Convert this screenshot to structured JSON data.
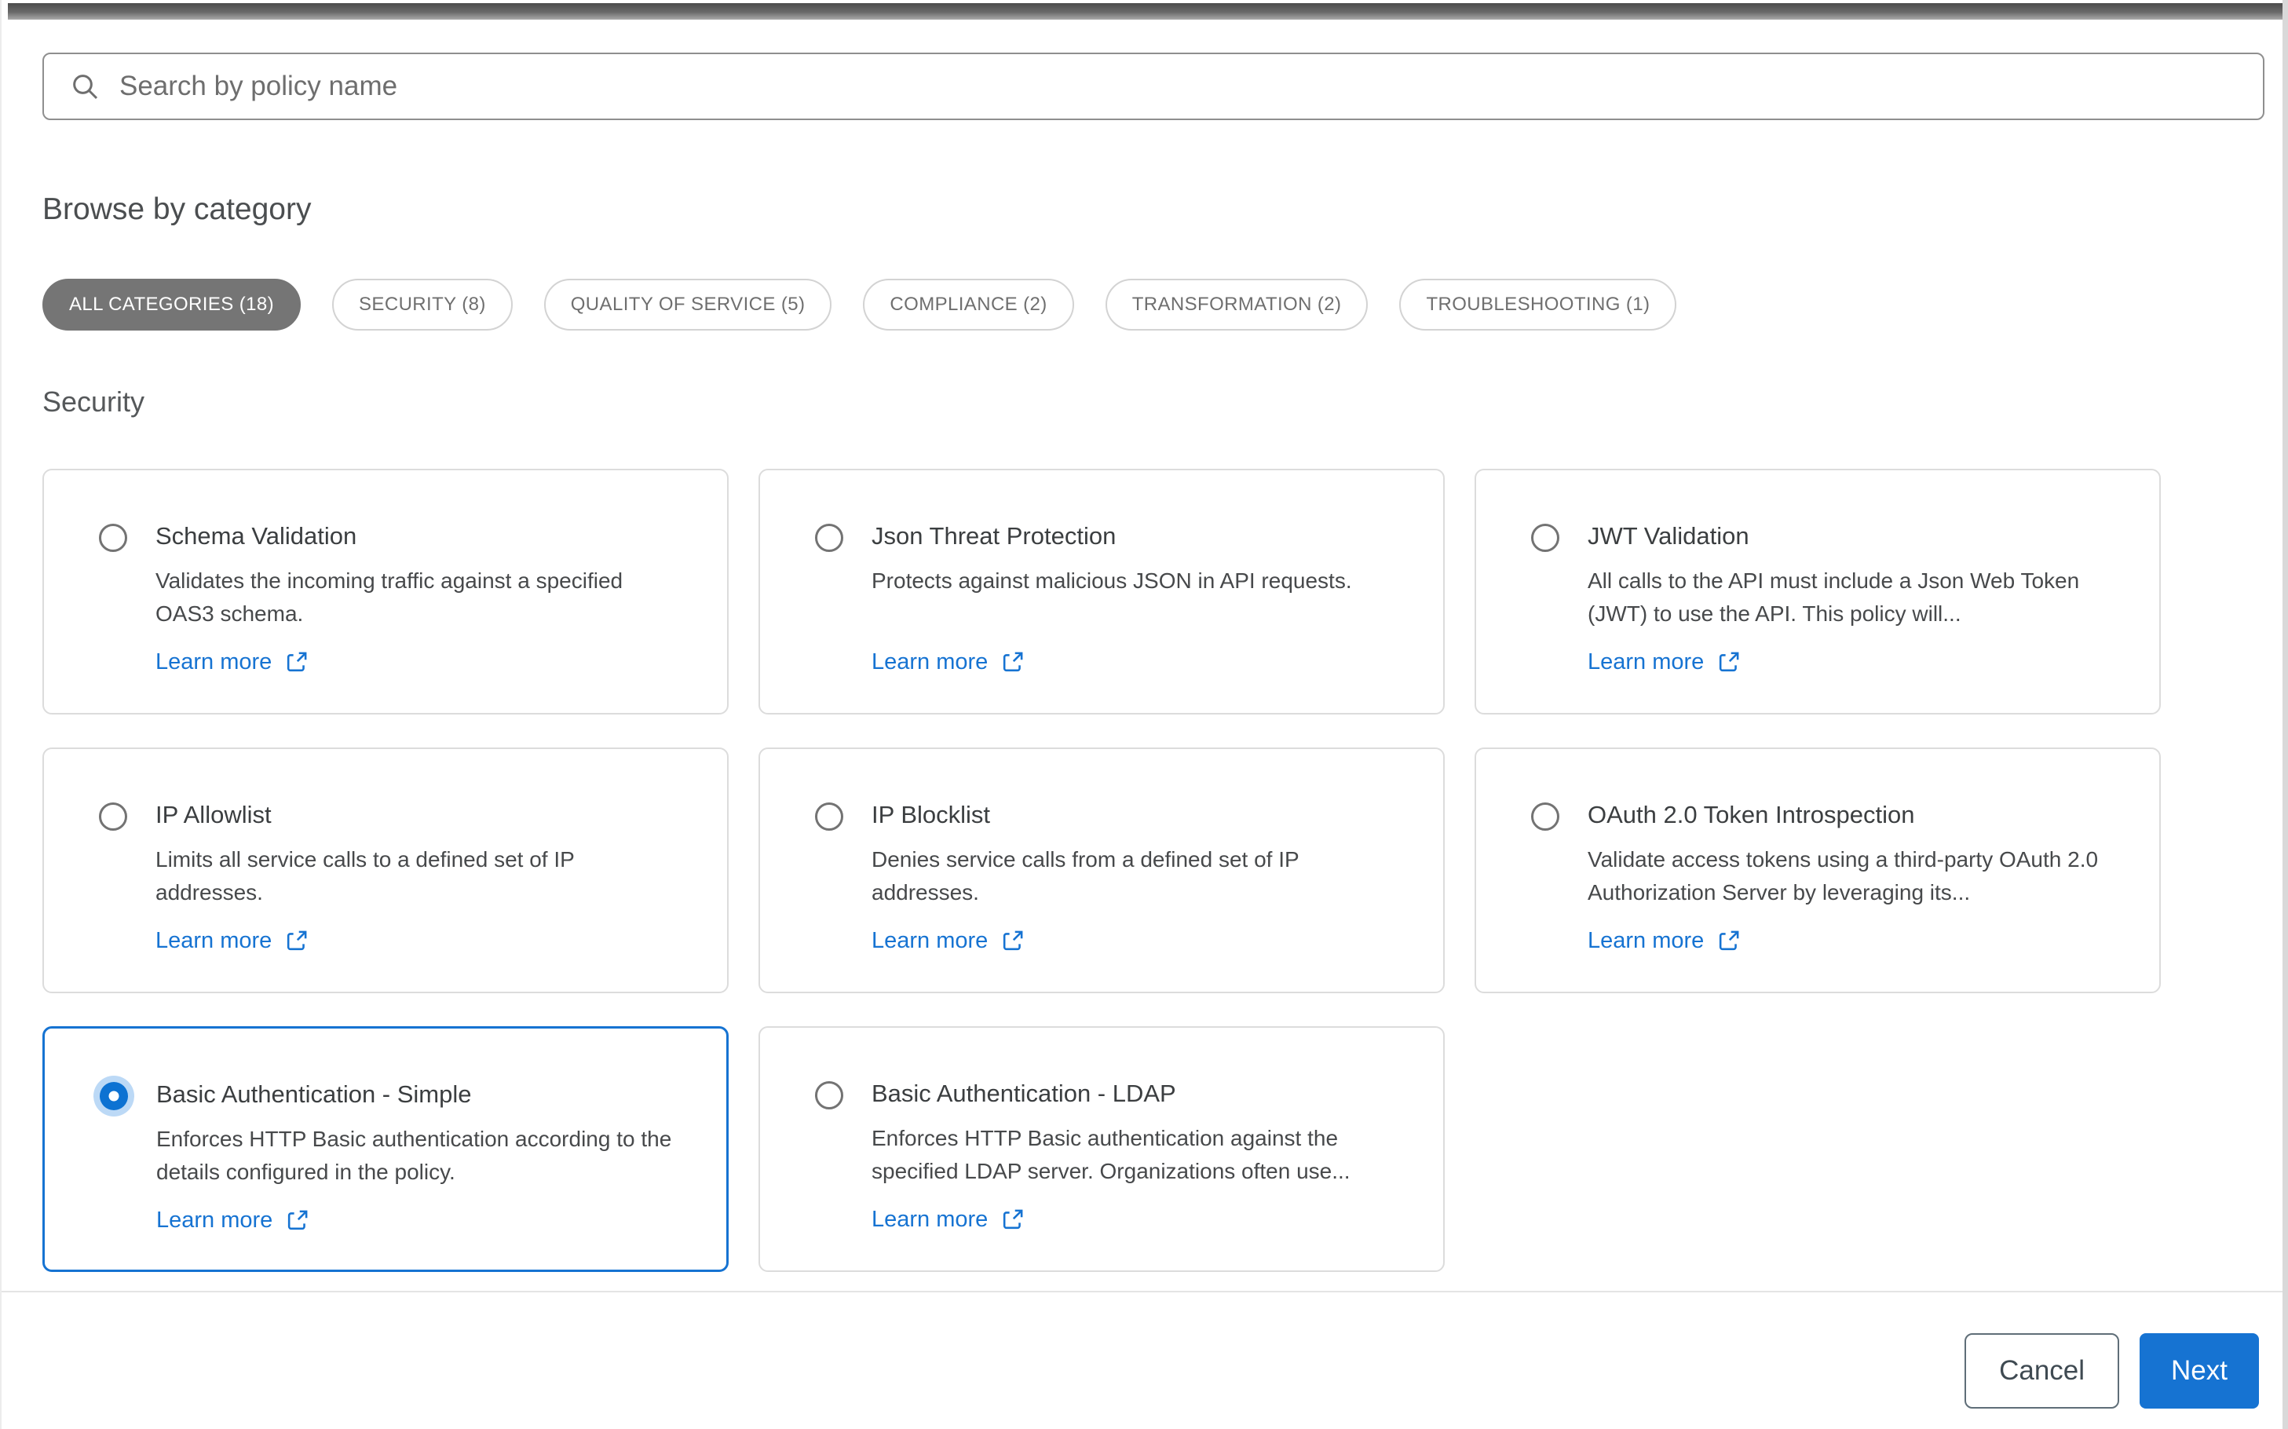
{
  "search": {
    "placeholder": "Search by policy name"
  },
  "browse_heading": "Browse by category",
  "section_heading": "Security",
  "categories": [
    {
      "label": "ALL CATEGORIES (18)",
      "selected": true
    },
    {
      "label": "SECURITY (8)",
      "selected": false
    },
    {
      "label": "QUALITY OF SERVICE (5)",
      "selected": false
    },
    {
      "label": "COMPLIANCE (2)",
      "selected": false
    },
    {
      "label": "TRANSFORMATION (2)",
      "selected": false
    },
    {
      "label": "TROUBLESHOOTING (1)",
      "selected": false
    }
  ],
  "policies": [
    {
      "title": "Schema Validation",
      "description": "Validates the incoming traffic against a specified OAS3 schema.",
      "link_label": "Learn more",
      "selected": false
    },
    {
      "title": "Json Threat Protection",
      "description": "Protects against malicious JSON in API requests.",
      "link_label": "Learn more",
      "selected": false
    },
    {
      "title": "JWT Validation",
      "description": "All calls to the API must include a Json Web Token (JWT) to use the API. This policy will...",
      "link_label": "Learn more",
      "selected": false
    },
    {
      "title": "IP Allowlist",
      "description": "Limits all service calls to a defined set of IP addresses.",
      "link_label": "Learn more",
      "selected": false
    },
    {
      "title": "IP Blocklist",
      "description": "Denies service calls from a defined set of IP addresses.",
      "link_label": "Learn more",
      "selected": false
    },
    {
      "title": "OAuth 2.0 Token Introspection",
      "description": "Validate access tokens using a third-party OAuth 2.0 Authorization Server by leveraging its...",
      "link_label": "Learn more",
      "selected": false
    },
    {
      "title": "Basic Authentication - Simple",
      "description": "Enforces HTTP Basic authentication according to the details configured in the policy.",
      "link_label": "Learn more",
      "selected": true
    },
    {
      "title": "Basic Authentication - LDAP",
      "description": "Enforces HTTP Basic authentication against the specified LDAP server. Organizations often use...",
      "link_label": "Learn more",
      "selected": false
    }
  ],
  "footer": {
    "cancel_label": "Cancel",
    "next_label": "Next"
  },
  "colors": {
    "accent_blue": "#1673d2",
    "selected_radio_halo": "#bcd9f6",
    "chip_selected_bg": "#757575",
    "top_bar_dark": "#4c4c4c"
  },
  "icons": {
    "search": "search-icon",
    "external_link": "external-link-icon"
  }
}
